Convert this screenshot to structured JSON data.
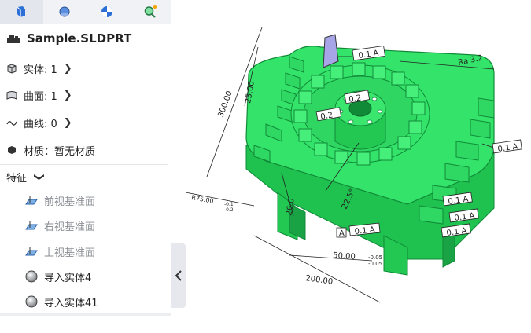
{
  "tabs": [
    {
      "name": "feature-tree-tab",
      "icon": "feature-tree-icon",
      "active": true
    },
    {
      "name": "property-tab",
      "icon": "property-icon",
      "active": false
    },
    {
      "name": "appearance-tab",
      "icon": "appearance-icon",
      "active": false
    },
    {
      "name": "search-tab",
      "icon": "search-icon",
      "active": false
    }
  ],
  "model": {
    "title": "Sample.SLDPRT"
  },
  "summary": {
    "solid": {
      "label": "实体: 1"
    },
    "surface": {
      "label": "曲面: 1"
    },
    "curve": {
      "label": "曲线: 0"
    },
    "material": {
      "label": "材质：暂无材质"
    }
  },
  "features": {
    "header": "特征",
    "items": [
      {
        "label": "前视基准面",
        "kind": "plane"
      },
      {
        "label": "右视基准面",
        "kind": "plane"
      },
      {
        "label": "上视基准面",
        "kind": "plane"
      },
      {
        "label": "导入实体4",
        "kind": "solid"
      },
      {
        "label": "导入实体41",
        "kind": "solid"
      }
    ]
  },
  "drawing": {
    "dims": {
      "d300": "300.00",
      "d25": "25.00",
      "d200": "200.00",
      "d50": "50.00",
      "d50tolU": "-0.05",
      "d50tolL": "-0.05",
      "r75": "R75.00",
      "r75tolU": "-0.1",
      "r75tolL": "-0.2",
      "d26": "26.0",
      "a22": "22.5°",
      "ra": "Ra 3.2",
      "flatA": "0.1 A",
      "perpA1": "0.1 A",
      "perpA2": "0.1 A",
      "perpA3": "0.1 A",
      "perpA4": "0.1 A",
      "circ1": "0.2",
      "circ2": "0.2",
      "datumA": "A",
      "bottomFcf": "0.1 A"
    }
  },
  "colors": {
    "body": "#34e46a",
    "edge": "#118a38",
    "shadow": "#1fc14f"
  }
}
